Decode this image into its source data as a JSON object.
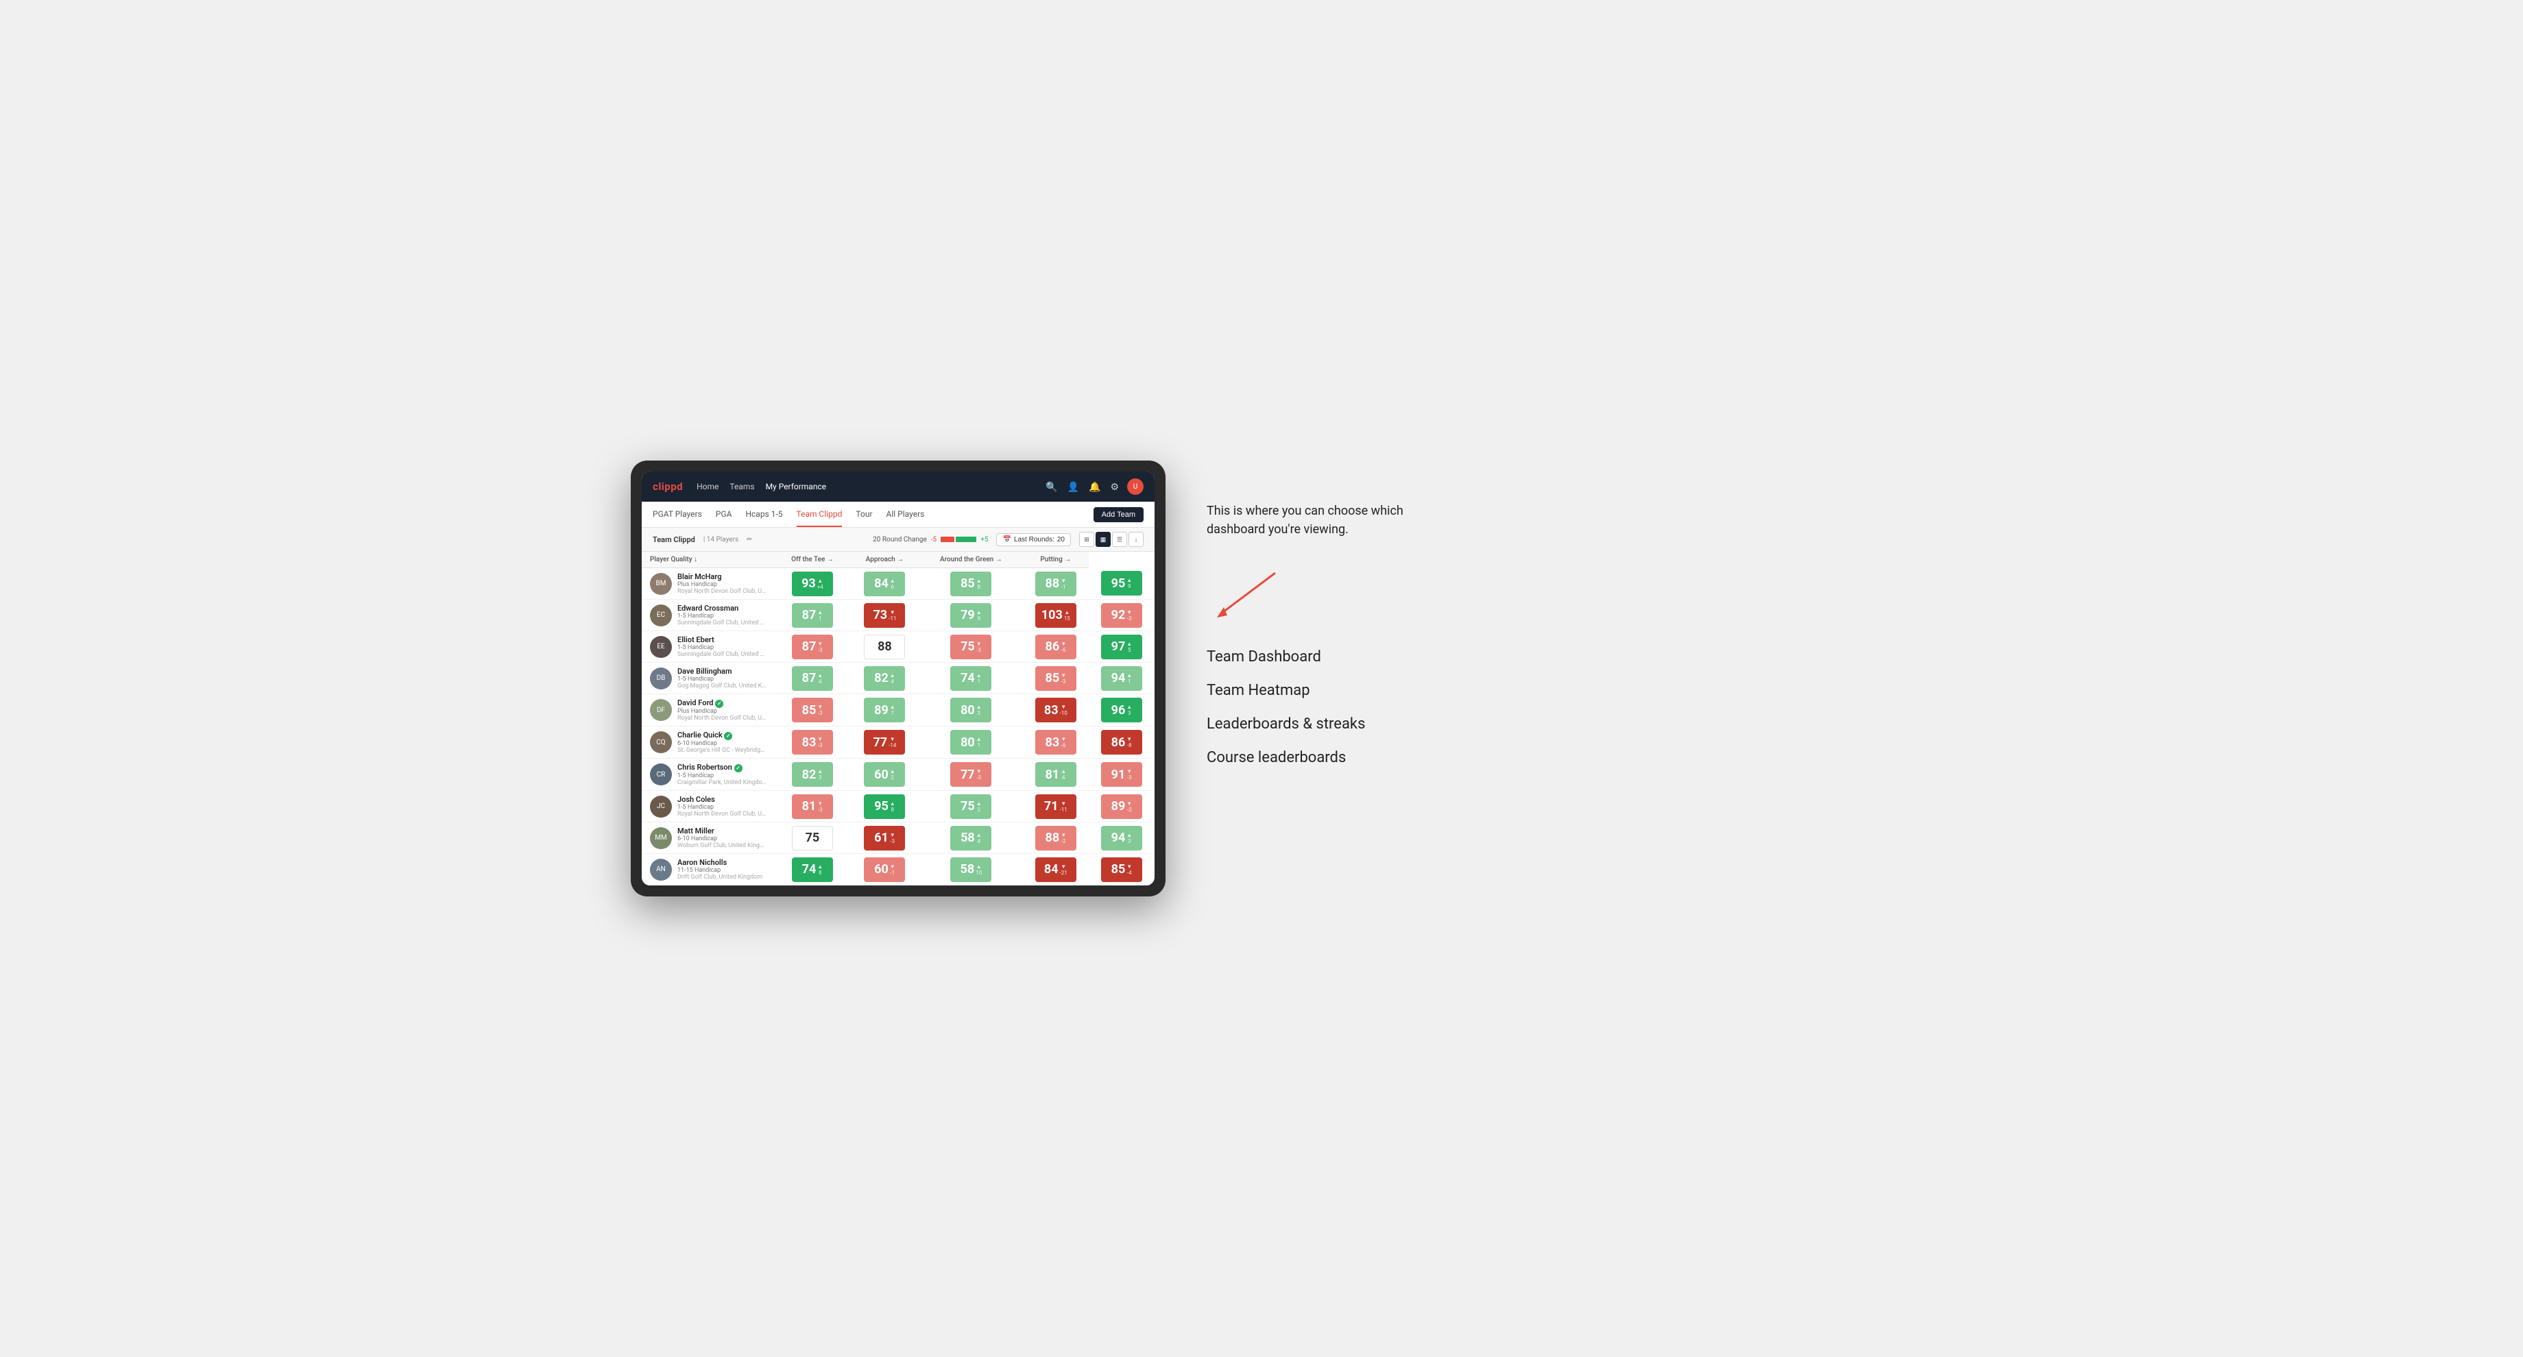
{
  "annotation": {
    "intro_text": "This is where you can choose which dashboard you're viewing.",
    "arrow_symbol": "→",
    "options": [
      {
        "id": "team-dashboard",
        "label": "Team Dashboard"
      },
      {
        "id": "team-heatmap",
        "label": "Team Heatmap"
      },
      {
        "id": "leaderboards",
        "label": "Leaderboards & streaks"
      },
      {
        "id": "course-leaderboards",
        "label": "Course leaderboards"
      }
    ]
  },
  "nav": {
    "logo": "clippd",
    "links": [
      {
        "id": "home",
        "label": "Home",
        "active": false
      },
      {
        "id": "teams",
        "label": "Teams",
        "active": false
      },
      {
        "id": "my-performance",
        "label": "My Performance",
        "active": true
      }
    ],
    "icons": [
      "search",
      "user",
      "bell",
      "settings",
      "avatar"
    ]
  },
  "sub_nav": {
    "links": [
      {
        "id": "pgat-players",
        "label": "PGAT Players",
        "active": false
      },
      {
        "id": "pga",
        "label": "PGA",
        "active": false
      },
      {
        "id": "hcaps-1-5",
        "label": "Hcaps 1-5",
        "active": false
      },
      {
        "id": "team-clippd",
        "label": "Team Clippd",
        "active": true
      },
      {
        "id": "tour",
        "label": "Tour",
        "active": false
      },
      {
        "id": "all-players",
        "label": "All Players",
        "active": false
      }
    ],
    "add_team_label": "Add Team"
  },
  "team_header": {
    "name": "Team Clippd",
    "separator": "|",
    "count_label": "14 Players",
    "round_change_label": "20 Round Change",
    "neg_label": "-5",
    "pos_label": "+5",
    "last_rounds_label": "Last Rounds:",
    "last_rounds_value": "20"
  },
  "columns": {
    "player_quality": "Player Quality ↓",
    "off_tee": "Off the Tee →",
    "approach": "Approach →",
    "around_green": "Around the Green →",
    "putting": "Putting →"
  },
  "players": [
    {
      "name": "Blair McHarg",
      "handicap": "Plus Handicap",
      "club": "Royal North Devon Golf Club, United Kingdom",
      "avatar_color": "#8e7b6e",
      "scores": {
        "player_quality": {
          "value": 93,
          "change": "+4",
          "dir": "up",
          "color": "green-dark"
        },
        "off_tee": {
          "value": 84,
          "change": "6",
          "dir": "up",
          "color": "green-light"
        },
        "approach": {
          "value": 85,
          "change": "8",
          "dir": "up",
          "color": "green-light"
        },
        "around_green": {
          "value": 88,
          "change": "-1",
          "dir": "down",
          "color": "green-light"
        },
        "putting": {
          "value": 95,
          "change": "9",
          "dir": "up",
          "color": "green-dark"
        }
      }
    },
    {
      "name": "Edward Crossman",
      "handicap": "1-5 Handicap",
      "club": "Sunningdale Golf Club, United Kingdom",
      "avatar_color": "#7a6e5a",
      "scores": {
        "player_quality": {
          "value": 87,
          "change": "1",
          "dir": "up",
          "color": "green-light"
        },
        "off_tee": {
          "value": 73,
          "change": "-11",
          "dir": "down",
          "color": "red-dark"
        },
        "approach": {
          "value": 79,
          "change": "9",
          "dir": "up",
          "color": "green-light"
        },
        "around_green": {
          "value": 103,
          "change": "15",
          "dir": "up",
          "color": "red-dark"
        },
        "putting": {
          "value": 92,
          "change": "-3",
          "dir": "down",
          "color": "red-light"
        }
      }
    },
    {
      "name": "Elliot Ebert",
      "handicap": "1-5 Handicap",
      "club": "Sunningdale Golf Club, United Kingdom",
      "avatar_color": "#5a4e4e",
      "scores": {
        "player_quality": {
          "value": 87,
          "change": "-3",
          "dir": "down",
          "color": "red-light"
        },
        "off_tee": {
          "value": 88,
          "change": "",
          "dir": "",
          "color": "white-bg"
        },
        "approach": {
          "value": 75,
          "change": "-3",
          "dir": "down",
          "color": "red-light"
        },
        "around_green": {
          "value": 86,
          "change": "-6",
          "dir": "down",
          "color": "red-light"
        },
        "putting": {
          "value": 97,
          "change": "5",
          "dir": "up",
          "color": "green-dark"
        }
      }
    },
    {
      "name": "Dave Billingham",
      "handicap": "1-5 Handicap",
      "club": "Gog Magog Golf Club, United Kingdom",
      "avatar_color": "#6e7a8a",
      "scores": {
        "player_quality": {
          "value": 87,
          "change": "4",
          "dir": "up",
          "color": "green-light"
        },
        "off_tee": {
          "value": 82,
          "change": "4",
          "dir": "up",
          "color": "green-light"
        },
        "approach": {
          "value": 74,
          "change": "1",
          "dir": "up",
          "color": "green-light"
        },
        "around_green": {
          "value": 85,
          "change": "-3",
          "dir": "down",
          "color": "red-light"
        },
        "putting": {
          "value": 94,
          "change": "1",
          "dir": "up",
          "color": "green-light"
        }
      }
    },
    {
      "name": "David Ford",
      "handicap": "Plus Handicap",
      "club": "Royal North Devon Golf Club, United Kingdom",
      "avatar_color": "#8a9a7a",
      "verified": true,
      "scores": {
        "player_quality": {
          "value": 85,
          "change": "-3",
          "dir": "down",
          "color": "red-light"
        },
        "off_tee": {
          "value": 89,
          "change": "7",
          "dir": "up",
          "color": "green-light"
        },
        "approach": {
          "value": 80,
          "change": "3",
          "dir": "up",
          "color": "green-light"
        },
        "around_green": {
          "value": 83,
          "change": "-10",
          "dir": "down",
          "color": "red-dark"
        },
        "putting": {
          "value": 96,
          "change": "3",
          "dir": "up",
          "color": "green-dark"
        }
      }
    },
    {
      "name": "Charlie Quick",
      "handicap": "6-10 Handicap",
      "club": "St. George's Hill GC - Weybridge - Surrey, Uni...",
      "avatar_color": "#7a6a5a",
      "verified": true,
      "scores": {
        "player_quality": {
          "value": 83,
          "change": "-3",
          "dir": "down",
          "color": "red-light"
        },
        "off_tee": {
          "value": 77,
          "change": "-14",
          "dir": "down",
          "color": "red-dark"
        },
        "approach": {
          "value": 80,
          "change": "1",
          "dir": "up",
          "color": "green-light"
        },
        "around_green": {
          "value": 83,
          "change": "-6",
          "dir": "down",
          "color": "red-light"
        },
        "putting": {
          "value": 86,
          "change": "-8",
          "dir": "down",
          "color": "red-dark"
        }
      }
    },
    {
      "name": "Chris Robertson",
      "handicap": "1-5 Handicap",
      "club": "Craigmillar Park, United Kingdom",
      "avatar_color": "#5a6a7a",
      "verified": true,
      "scores": {
        "player_quality": {
          "value": 82,
          "change": "3",
          "dir": "up",
          "color": "green-light"
        },
        "off_tee": {
          "value": 60,
          "change": "2",
          "dir": "up",
          "color": "green-light"
        },
        "approach": {
          "value": 77,
          "change": "-3",
          "dir": "down",
          "color": "red-light"
        },
        "around_green": {
          "value": 81,
          "change": "4",
          "dir": "up",
          "color": "green-light"
        },
        "putting": {
          "value": 91,
          "change": "-3",
          "dir": "down",
          "color": "red-light"
        }
      }
    },
    {
      "name": "Josh Coles",
      "handicap": "1-5 Handicap",
      "club": "Royal North Devon Golf Club, United Kingdom",
      "avatar_color": "#6a5a4a",
      "scores": {
        "player_quality": {
          "value": 81,
          "change": "-3",
          "dir": "down",
          "color": "red-light"
        },
        "off_tee": {
          "value": 95,
          "change": "8",
          "dir": "up",
          "color": "green-dark"
        },
        "approach": {
          "value": 75,
          "change": "2",
          "dir": "up",
          "color": "green-light"
        },
        "around_green": {
          "value": 71,
          "change": "-11",
          "dir": "down",
          "color": "red-dark"
        },
        "putting": {
          "value": 89,
          "change": "-2",
          "dir": "down",
          "color": "red-light"
        }
      }
    },
    {
      "name": "Matt Miller",
      "handicap": "6-10 Handicap",
      "club": "Woburn Golf Club, United Kingdom",
      "avatar_color": "#7a8a6a",
      "scores": {
        "player_quality": {
          "value": 75,
          "change": "",
          "dir": "",
          "color": "white-bg"
        },
        "off_tee": {
          "value": 61,
          "change": "-3",
          "dir": "down",
          "color": "red-dark"
        },
        "approach": {
          "value": 58,
          "change": "4",
          "dir": "up",
          "color": "green-light"
        },
        "around_green": {
          "value": 88,
          "change": "-2",
          "dir": "down",
          "color": "red-light"
        },
        "putting": {
          "value": 94,
          "change": "3",
          "dir": "up",
          "color": "green-light"
        }
      }
    },
    {
      "name": "Aaron Nicholls",
      "handicap": "11-15 Handicap",
      "club": "Drift Golf Club, United Kingdom",
      "avatar_color": "#6a7a8a",
      "scores": {
        "player_quality": {
          "value": 74,
          "change": "8",
          "dir": "up",
          "color": "green-dark"
        },
        "off_tee": {
          "value": 60,
          "change": "-1",
          "dir": "down",
          "color": "red-light"
        },
        "approach": {
          "value": 58,
          "change": "10",
          "dir": "up",
          "color": "green-light"
        },
        "around_green": {
          "value": 84,
          "change": "-21",
          "dir": "down",
          "color": "red-dark"
        },
        "putting": {
          "value": 85,
          "change": "-4",
          "dir": "down",
          "color": "red-dark"
        }
      }
    }
  ]
}
